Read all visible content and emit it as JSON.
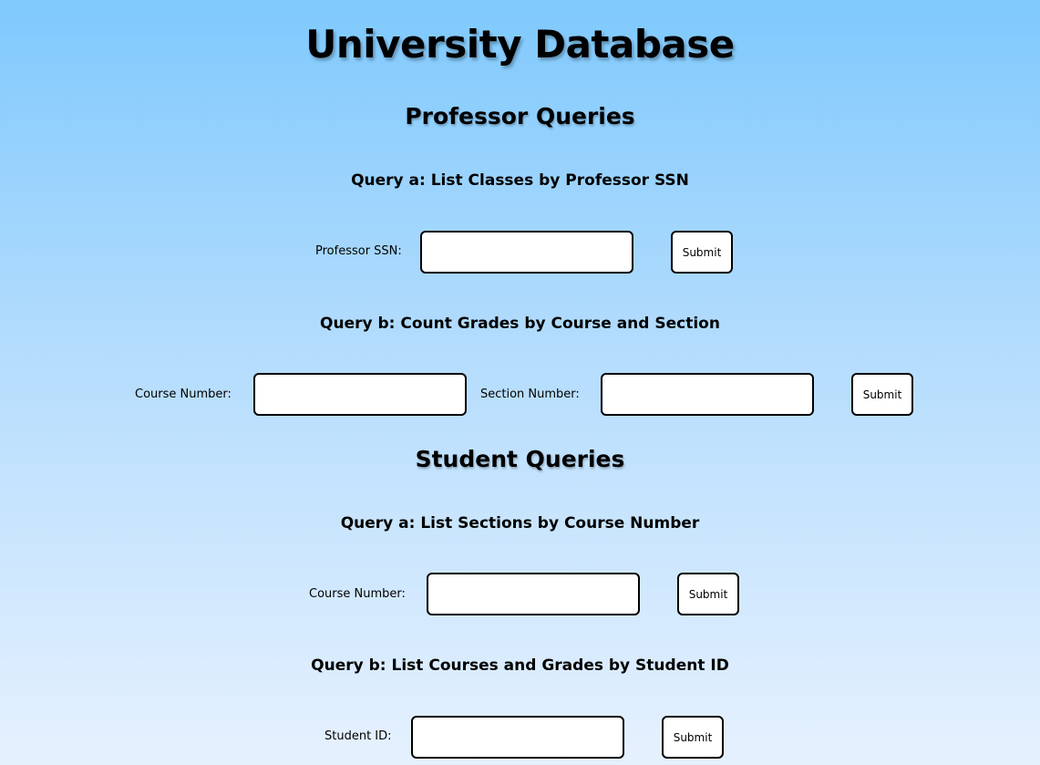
{
  "page": {
    "title": "University Database"
  },
  "professor": {
    "heading": "Professor Queries",
    "query_a": {
      "title": "Query a: List Classes by Professor SSN",
      "ssn_label": "Professor SSN:",
      "ssn_value": "",
      "submit_label": "Submit"
    },
    "query_b": {
      "title": "Query b: Count Grades by Course and Section",
      "course_label": "Course Number:",
      "course_value": "",
      "section_label": "Section Number:",
      "section_value": "",
      "submit_label": "Submit"
    }
  },
  "student": {
    "heading": "Student Queries",
    "query_a": {
      "title": "Query a: List Sections by Course Number",
      "course_label": "Course Number:",
      "course_value": "",
      "submit_label": "Submit"
    },
    "query_b": {
      "title": "Query b: List Courses and Grades by Student ID",
      "student_label": "Student ID:",
      "student_value": "",
      "submit_label": "Submit"
    }
  }
}
